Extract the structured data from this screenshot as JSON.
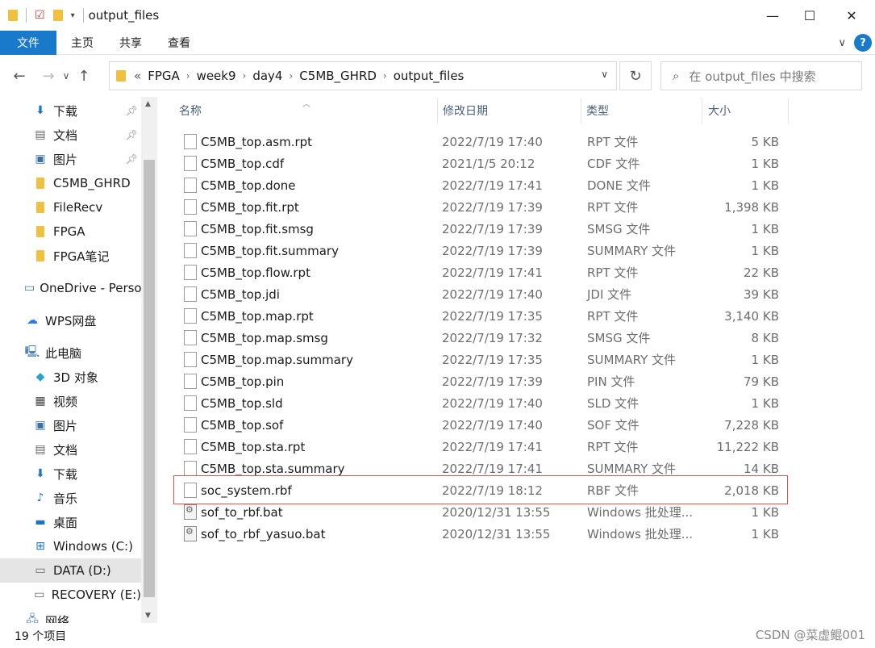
{
  "window": {
    "title": "output_files",
    "minimize": "—",
    "maximize": "☐",
    "close": "✕"
  },
  "ribbon": {
    "tabs": [
      "文件",
      "主页",
      "共享",
      "查看"
    ],
    "collapse": "∨",
    "help": "?"
  },
  "nav": {
    "back": "←",
    "forward": "→",
    "recent": "∨",
    "up": "↑"
  },
  "address": {
    "overflow": "«",
    "crumbs": [
      "FPGA",
      "week9",
      "day4",
      "C5MB_GHRD",
      "output_files"
    ],
    "dropdown": "∨",
    "refresh": "↻"
  },
  "search": {
    "placeholder": "在 output_files 中搜索"
  },
  "navpane": {
    "quick": [
      {
        "label": "下载",
        "icon": "download-icon",
        "pinned": true
      },
      {
        "label": "文档",
        "icon": "document-icon",
        "pinned": true
      },
      {
        "label": "图片",
        "icon": "picture-icon",
        "pinned": true
      },
      {
        "label": "C5MB_GHRD",
        "icon": "folder-icon",
        "pinned": false
      },
      {
        "label": "FileRecv",
        "icon": "folder-icon",
        "pinned": false
      },
      {
        "label": "FPGA",
        "icon": "folder-icon",
        "pinned": false
      },
      {
        "label": "FPGA笔记",
        "icon": "folder-icon",
        "pinned": false
      }
    ],
    "onedrive": "OneDrive - Perso",
    "wps": "WPS网盘",
    "thispc": "此电脑",
    "pc_items": [
      {
        "label": "3D 对象",
        "icon": "cube-icon"
      },
      {
        "label": "视频",
        "icon": "video-icon"
      },
      {
        "label": "图片",
        "icon": "picture-icon"
      },
      {
        "label": "文档",
        "icon": "document-icon"
      },
      {
        "label": "下载",
        "icon": "download-icon"
      },
      {
        "label": "音乐",
        "icon": "music-icon"
      },
      {
        "label": "桌面",
        "icon": "desktop-icon"
      },
      {
        "label": "Windows (C:)",
        "icon": "drive-icon"
      },
      {
        "label": "DATA (D:)",
        "icon": "drive-icon"
      },
      {
        "label": "RECOVERY (E:)",
        "icon": "drive-icon"
      }
    ],
    "network": "网络"
  },
  "columns": {
    "name": "名称",
    "date": "修改日期",
    "type": "类型",
    "size": "大小"
  },
  "files": [
    {
      "name": "C5MB_top.asm.rpt",
      "date": "2022/7/19 17:40",
      "type": "RPT 文件",
      "size": "5 KB",
      "kind": "file"
    },
    {
      "name": "C5MB_top.cdf",
      "date": "2021/1/5 20:12",
      "type": "CDF 文件",
      "size": "1 KB",
      "kind": "file"
    },
    {
      "name": "C5MB_top.done",
      "date": "2022/7/19 17:41",
      "type": "DONE 文件",
      "size": "1 KB",
      "kind": "file"
    },
    {
      "name": "C5MB_top.fit.rpt",
      "date": "2022/7/19 17:39",
      "type": "RPT 文件",
      "size": "1,398 KB",
      "kind": "file"
    },
    {
      "name": "C5MB_top.fit.smsg",
      "date": "2022/7/19 17:39",
      "type": "SMSG 文件",
      "size": "1 KB",
      "kind": "file"
    },
    {
      "name": "C5MB_top.fit.summary",
      "date": "2022/7/19 17:39",
      "type": "SUMMARY 文件",
      "size": "1 KB",
      "kind": "file"
    },
    {
      "name": "C5MB_top.flow.rpt",
      "date": "2022/7/19 17:41",
      "type": "RPT 文件",
      "size": "22 KB",
      "kind": "file"
    },
    {
      "name": "C5MB_top.jdi",
      "date": "2022/7/19 17:40",
      "type": "JDI 文件",
      "size": "39 KB",
      "kind": "file"
    },
    {
      "name": "C5MB_top.map.rpt",
      "date": "2022/7/19 17:35",
      "type": "RPT 文件",
      "size": "3,140 KB",
      "kind": "file"
    },
    {
      "name": "C5MB_top.map.smsg",
      "date": "2022/7/19 17:32",
      "type": "SMSG 文件",
      "size": "8 KB",
      "kind": "file"
    },
    {
      "name": "C5MB_top.map.summary",
      "date": "2022/7/19 17:35",
      "type": "SUMMARY 文件",
      "size": "1 KB",
      "kind": "file"
    },
    {
      "name": "C5MB_top.pin",
      "date": "2022/7/19 17:39",
      "type": "PIN 文件",
      "size": "79 KB",
      "kind": "file"
    },
    {
      "name": "C5MB_top.sld",
      "date": "2022/7/19 17:40",
      "type": "SLD 文件",
      "size": "1 KB",
      "kind": "file"
    },
    {
      "name": "C5MB_top.sof",
      "date": "2022/7/19 17:40",
      "type": "SOF 文件",
      "size": "7,228 KB",
      "kind": "file"
    },
    {
      "name": "C5MB_top.sta.rpt",
      "date": "2022/7/19 17:41",
      "type": "RPT 文件",
      "size": "11,222 KB",
      "kind": "file"
    },
    {
      "name": "C5MB_top.sta.summary",
      "date": "2022/7/19 17:41",
      "type": "SUMMARY 文件",
      "size": "14 KB",
      "kind": "file"
    },
    {
      "name": "soc_system.rbf",
      "date": "2022/7/19 18:12",
      "type": "RBF 文件",
      "size": "2,018 KB",
      "kind": "file",
      "highlighted": true
    },
    {
      "name": "sof_to_rbf.bat",
      "date": "2020/12/31 13:55",
      "type": "Windows 批处理...",
      "size": "1 KB",
      "kind": "bat"
    },
    {
      "name": "sof_to_rbf_yasuo.bat",
      "date": "2020/12/31 13:55",
      "type": "Windows 批处理...",
      "size": "1 KB",
      "kind": "bat"
    }
  ],
  "status": {
    "count": "19 个项目"
  },
  "watermark": "CSDN @菜虚鲲001",
  "colors": {
    "accent": "#1979ca",
    "highlight_border": "#d9534f",
    "selected_bg": "#cde8ff"
  }
}
